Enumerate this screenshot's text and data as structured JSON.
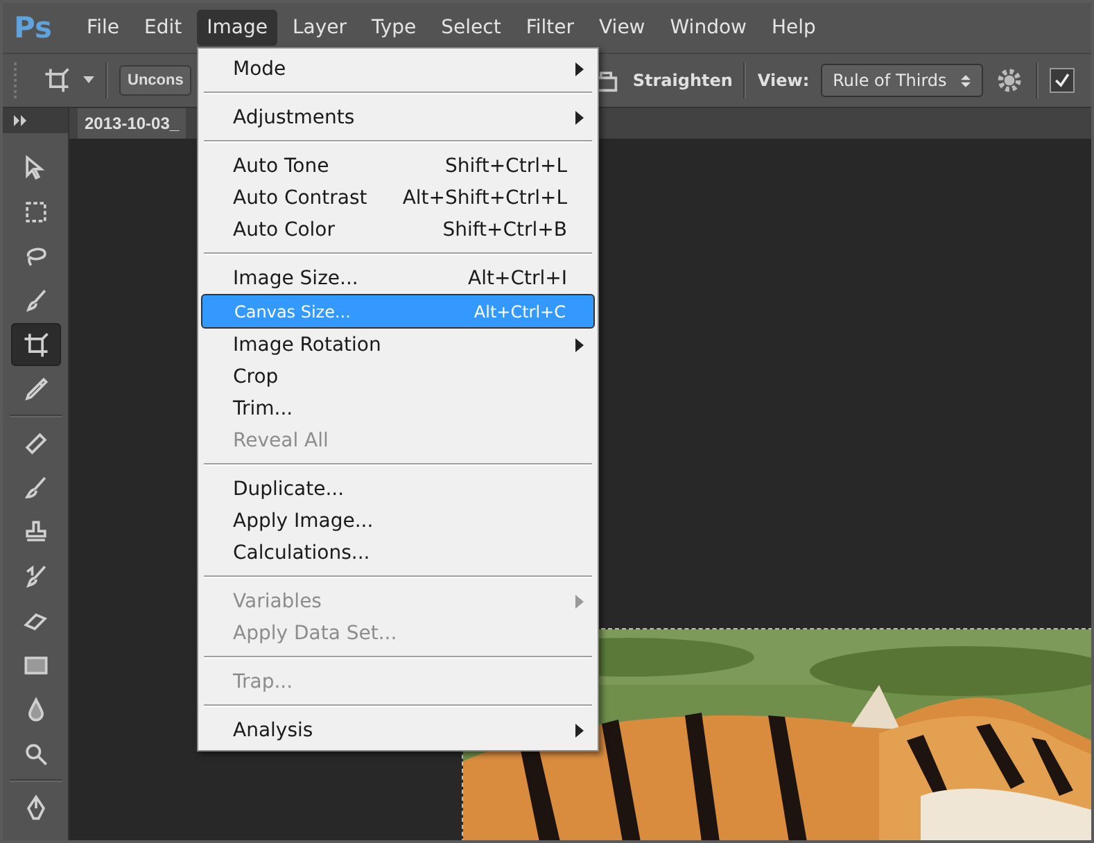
{
  "menubar": {
    "logo": "Ps",
    "items": [
      {
        "label": "File",
        "selected": false
      },
      {
        "label": "Edit",
        "selected": false
      },
      {
        "label": "Image",
        "selected": true
      },
      {
        "label": "Layer",
        "selected": false
      },
      {
        "label": "Type",
        "selected": false
      },
      {
        "label": "Select",
        "selected": false
      },
      {
        "label": "Filter",
        "selected": false
      },
      {
        "label": "View",
        "selected": false
      },
      {
        "label": "Window",
        "selected": false
      },
      {
        "label": "Help",
        "selected": false
      }
    ]
  },
  "options_bar": {
    "ratio_dropdown": "Uncons",
    "straighten": "Straighten",
    "view_label": "View:",
    "view_select": "Rule of Thirds",
    "checkbox_checked": true
  },
  "document_tab": "2013-10-03_",
  "tool_groups": [
    [
      {
        "selected": false
      },
      {
        "selected": false
      },
      {
        "selected": false
      },
      {
        "selected": false
      },
      {
        "selected": true
      },
      {
        "selected": false
      }
    ],
    [
      {
        "selected": false
      },
      {
        "selected": false
      },
      {
        "selected": false
      },
      {
        "selected": false
      },
      {
        "selected": false
      },
      {
        "selected": false
      },
      {
        "selected": false
      },
      {
        "selected": false
      }
    ],
    [
      {
        "selected": false
      }
    ]
  ],
  "menu": {
    "sections": [
      [
        {
          "label": "Mode",
          "submenu": true,
          "disabled": false,
          "selected": false
        }
      ],
      [
        {
          "label": "Adjustments",
          "submenu": true,
          "disabled": false,
          "selected": false
        }
      ],
      [
        {
          "label": "Auto Tone",
          "shortcut": "Shift+Ctrl+L",
          "submenu": false,
          "disabled": false,
          "selected": false
        },
        {
          "label": "Auto Contrast",
          "shortcut": "Alt+Shift+Ctrl+L",
          "submenu": false,
          "disabled": false,
          "selected": false
        },
        {
          "label": "Auto Color",
          "shortcut": "Shift+Ctrl+B",
          "submenu": false,
          "disabled": false,
          "selected": false
        }
      ],
      [
        {
          "label": "Image Size...",
          "shortcut": "Alt+Ctrl+I",
          "submenu": false,
          "disabled": false,
          "selected": false
        },
        {
          "label": "Canvas Size...",
          "shortcut": "Alt+Ctrl+C",
          "submenu": false,
          "disabled": false,
          "selected": true
        },
        {
          "label": "Image Rotation",
          "submenu": true,
          "disabled": false,
          "selected": false
        },
        {
          "label": "Crop",
          "submenu": false,
          "disabled": false,
          "selected": false
        },
        {
          "label": "Trim...",
          "submenu": false,
          "disabled": false,
          "selected": false
        },
        {
          "label": "Reveal All",
          "submenu": false,
          "disabled": true,
          "selected": false
        }
      ],
      [
        {
          "label": "Duplicate...",
          "submenu": false,
          "disabled": false,
          "selected": false
        },
        {
          "label": "Apply Image...",
          "submenu": false,
          "disabled": false,
          "selected": false
        },
        {
          "label": "Calculations...",
          "submenu": false,
          "disabled": false,
          "selected": false
        }
      ],
      [
        {
          "label": "Variables",
          "submenu": true,
          "disabled": true,
          "selected": false
        },
        {
          "label": "Apply Data Set...",
          "submenu": false,
          "disabled": true,
          "selected": false
        }
      ],
      [
        {
          "label": "Trap...",
          "submenu": false,
          "disabled": true,
          "selected": false
        }
      ],
      [
        {
          "label": "Analysis",
          "submenu": true,
          "disabled": false,
          "selected": false
        }
      ]
    ]
  }
}
